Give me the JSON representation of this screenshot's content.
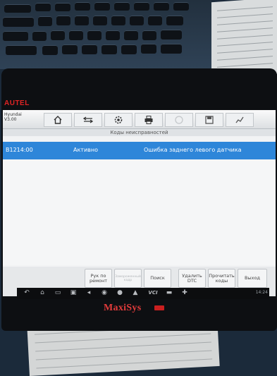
{
  "device": {
    "brand_top": "AUTEL",
    "brand_bottom": "MaxiSys",
    "accent_color": "#2e86d9"
  },
  "header": {
    "vehicle_make": "Hyundai",
    "vehicle_version": "V3.00",
    "toolbar_icons": [
      "home-icon",
      "vehicle-swap-icon",
      "settings-icon",
      "print-icon",
      "help-icon",
      "save-icon",
      "data-logging-icon"
    ]
  },
  "screen": {
    "title": "Коды неисправностей"
  },
  "dtc_list": [
    {
      "code": "B1214:00",
      "status": "Активно",
      "description": "Ошибка заднего левого датчика"
    }
  ],
  "function_buttons": {
    "manual": "Рук по ремонт",
    "freeze_frame": "Замороженный кадр",
    "search": "Поиск",
    "clear_dtc": "Удалить DTC",
    "read_codes": "Прочитать коды",
    "exit": "Выход"
  },
  "status_bar": {
    "time": "14:24"
  }
}
